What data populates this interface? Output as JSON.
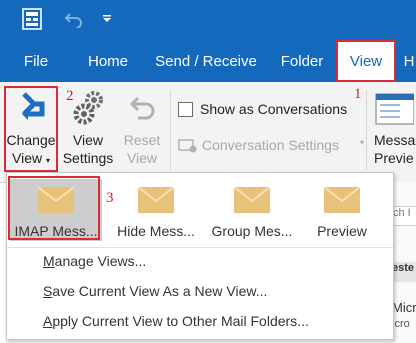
{
  "tabs": [
    "File",
    "Home",
    "Send / Receive",
    "Folder",
    "View",
    "H"
  ],
  "ribbon": {
    "change_view": [
      "Change",
      "View"
    ],
    "view_settings": [
      "View",
      "Settings"
    ],
    "reset_view": [
      "Reset",
      "View"
    ],
    "show_as_conversations": "Show as Conversations",
    "conversation_settings": "Conversation Settings",
    "message_preview": [
      "Messa",
      "Previe"
    ]
  },
  "annotations": [
    "1",
    "2",
    "3"
  ],
  "dropdown": {
    "views": [
      "IMAP Mess...",
      "Hide Mess...",
      "Group Mes...",
      "Preview"
    ],
    "menu": {
      "manage_first": "M",
      "manage_rest": "anage Views...",
      "save_first": "S",
      "save_rest": "ave Current View As a New View...",
      "apply_first": "A",
      "apply_rest": "pply Current View to Other Mail Folders..."
    }
  },
  "side": {
    "search_hint": "ch I",
    "header_hint": "este",
    "row1": "Micr",
    "row2": "icro"
  },
  "colors": {
    "brand": "#1469bd",
    "annotation": "#e0191b",
    "envelope": "#e8c27a"
  }
}
